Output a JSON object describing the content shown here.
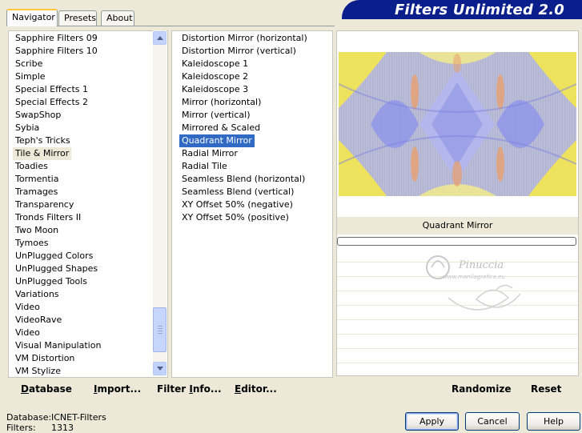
{
  "tabs": [
    {
      "label": "Navigator"
    },
    {
      "label": "Presets"
    },
    {
      "label": "About"
    }
  ],
  "banner": {
    "title": "Filters Unlimited 2.0"
  },
  "categories": {
    "items": [
      "Sapphire Filters 09",
      "Sapphire Filters 10",
      "Scribe",
      "Simple",
      "Special Effects 1",
      "Special Effects 2",
      "SwapShop",
      "Sybia",
      "Teph's Tricks",
      "Tile & Mirror",
      "Toadies",
      "Tormentia",
      "Tramages",
      "Transparency",
      "Tronds Filters II",
      "Two Moon",
      "Tymoes",
      "UnPlugged Colors",
      "UnPlugged Shapes",
      "UnPlugged Tools",
      "Variations",
      "Video",
      "VideoRave",
      "Video",
      "Visual Manipulation",
      "VM Distortion",
      "VM Stylize"
    ],
    "selected": "Tile & Mirror"
  },
  "filters": {
    "items": [
      "Distortion Mirror (horizontal)",
      "Distortion Mirror (vertical)",
      "Kaleidoscope 1",
      "Kaleidoscope 2",
      "Kaleidoscope 3",
      "Mirror (horizontal)",
      "Mirror (vertical)",
      "Mirrored & Scaled",
      "Quadrant Mirror",
      "Radial Mirror",
      "Radial Tile",
      "Seamless Blend (horizontal)",
      "Seamless Blend (vertical)",
      "XY Offset 50% (negative)",
      "XY Offset 50% (positive)"
    ],
    "selected": "Quadrant Mirror"
  },
  "preview": {
    "filter_name": "Quadrant Mirror",
    "watermark": "Pinuccia",
    "watermark_url": "www.manilagrafica.eu",
    "colors": {
      "blue": "#8c96f0",
      "yellow": "#f5e650",
      "orange": "#e8a070"
    }
  },
  "toolbar": {
    "database": {
      "underline": "D",
      "rest": "atabase"
    },
    "import": {
      "underline": "I",
      "rest": "mport..."
    },
    "filter_info": {
      "pre": "Filter ",
      "underline": "I",
      "rest": "nfo..."
    },
    "editor": {
      "underline": "E",
      "rest": "ditor..."
    },
    "randomize": "Randomize",
    "reset": "Reset"
  },
  "status": {
    "database_label": "Database:",
    "database_value": "ICNET-Filters",
    "filters_label": "Filters:",
    "filters_value": "1313"
  },
  "buttons": {
    "apply": "Apply",
    "cancel": "Cancel",
    "help": "Help"
  }
}
